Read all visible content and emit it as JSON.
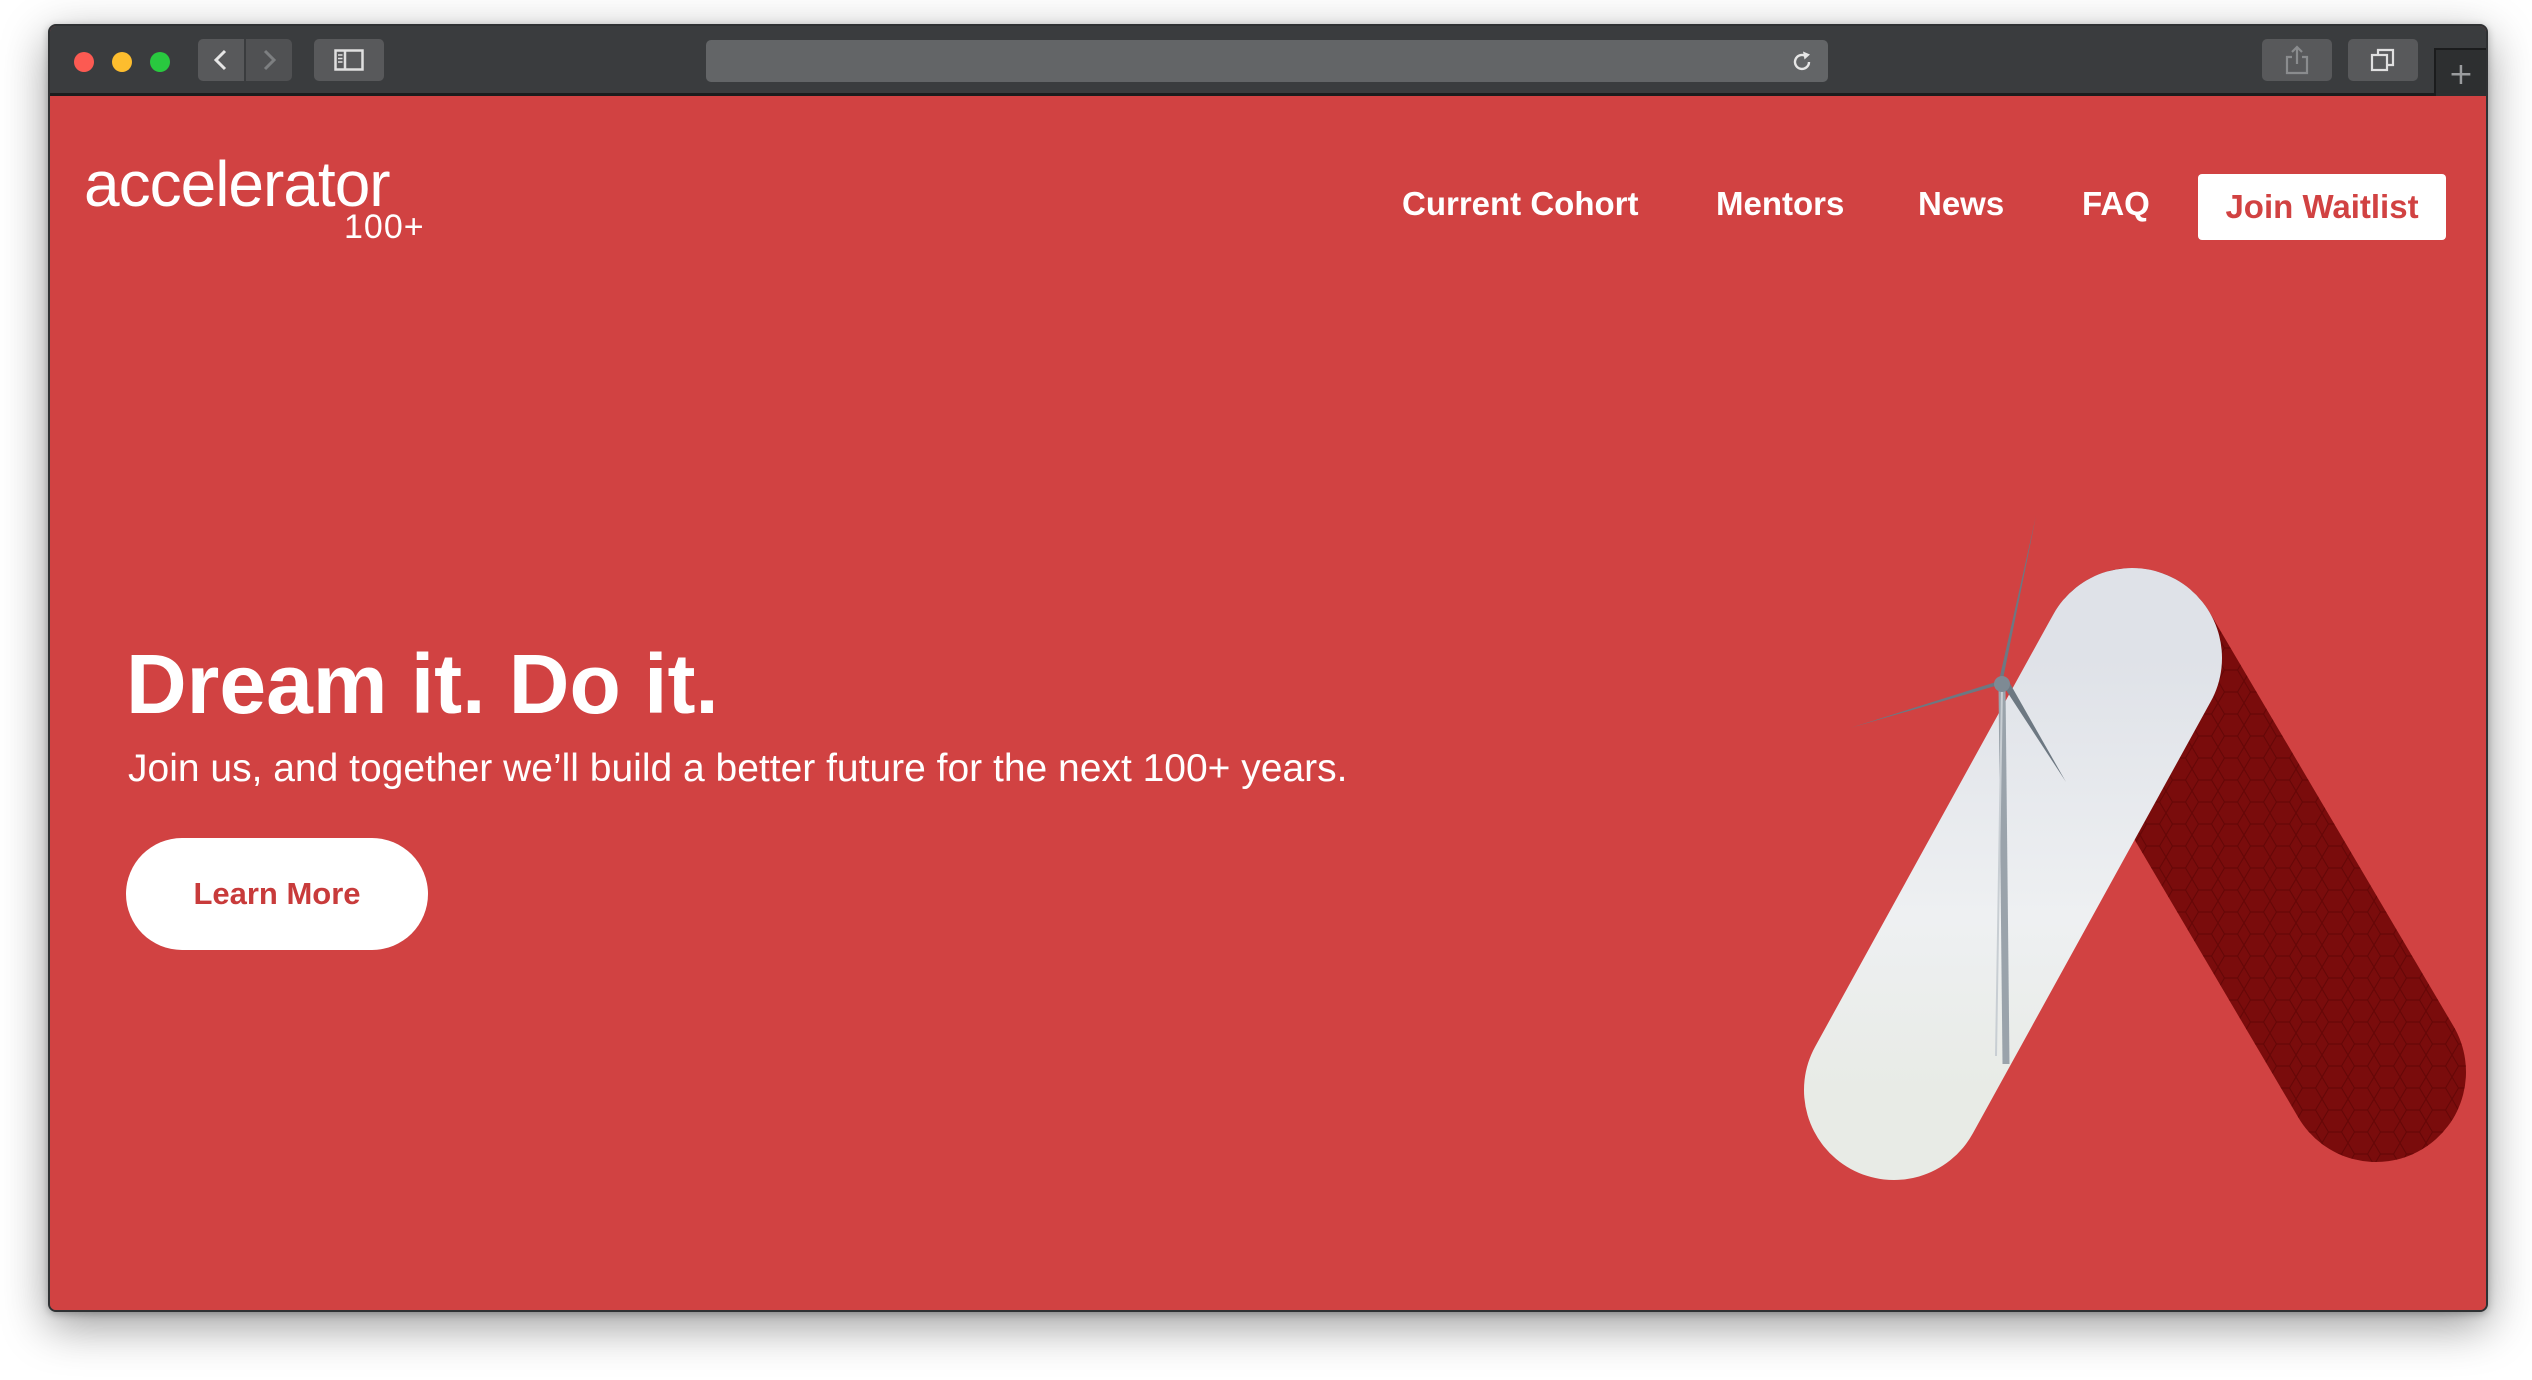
{
  "browser": {
    "controls": {
      "close_color": "#fc5a52",
      "minimize_color": "#fdbd2e",
      "zoom_color": "#29c93f"
    },
    "address_bar": {
      "url": ""
    },
    "new_tab_symbol": "+"
  },
  "site": {
    "logo": {
      "name": "accelerator",
      "suffix": "100+"
    },
    "nav": {
      "items": [
        "Current Cohort",
        "Mentors",
        "News",
        "FAQ"
      ],
      "cta": "Join Waitlist"
    },
    "hero": {
      "headline": "Dream it. Do it.",
      "subheadline": "Join us, and together we’ll build a better future for the next 100+ years.",
      "button": "Learn More",
      "illustration": "A-shaped logo mark with wind turbine photo"
    },
    "colors": {
      "brand_red": "#d14242",
      "dark_red": "#7a0c0c",
      "white": "#ffffff"
    }
  }
}
